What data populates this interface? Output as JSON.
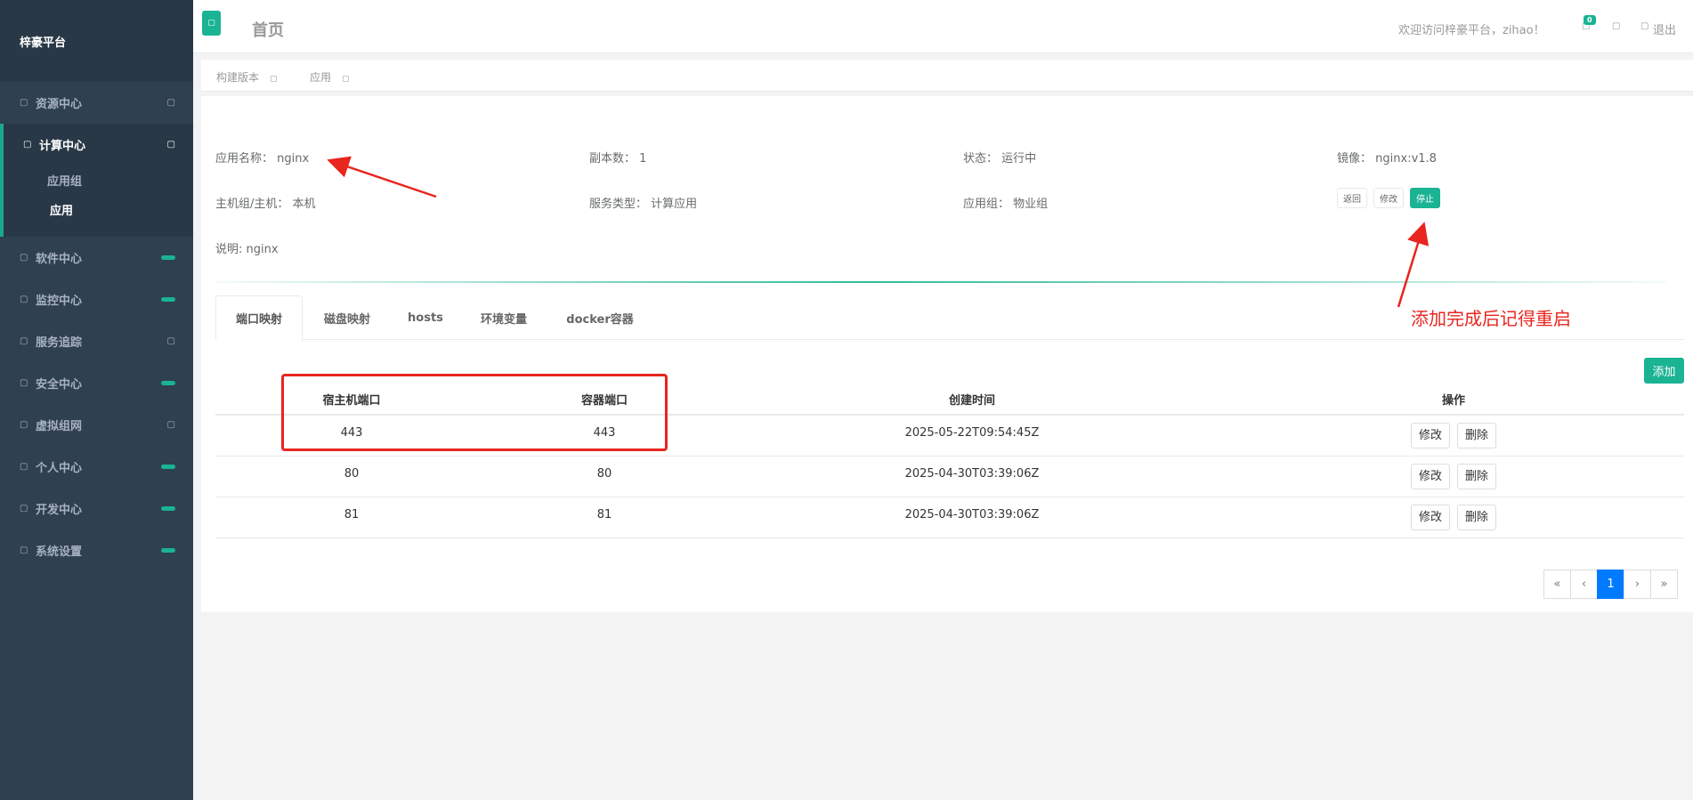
{
  "sidebar": {
    "brand": "梓豪平台",
    "items": [
      {
        "label": "资源中心"
      },
      {
        "label": "计算中心"
      },
      {
        "label": "软件中心"
      },
      {
        "label": "监控中心"
      },
      {
        "label": "服务追踪"
      },
      {
        "label": "安全中心"
      },
      {
        "label": "虚拟组网"
      },
      {
        "label": "个人中心"
      },
      {
        "label": "开发中心"
      },
      {
        "label": "系统设置"
      }
    ],
    "sub_items": [
      {
        "label": "应用组"
      },
      {
        "label": "应用"
      }
    ],
    "accent": "#1ab394"
  },
  "topbar": {
    "title": "首页",
    "welcome": "欢迎访问梓豪平台，zihao！",
    "badge": "0",
    "logout": "退出"
  },
  "page_tabs": [
    {
      "label": "构建版本"
    },
    {
      "label": "应用"
    }
  ],
  "details": {
    "name_label": "应用名称：",
    "name_value": "nginx",
    "replicas_label": "副本数：",
    "replicas_value": "1",
    "status_label": "状态：",
    "status_value": "运行中",
    "image_label": "镜像：",
    "image_value": "nginx:v1.8",
    "host_label": "主机组/主机：",
    "host_value": "本机",
    "service_type_label": "服务类型：",
    "service_type_value": "计算应用",
    "app_group_label": "应用组：",
    "app_group_value": "物业组",
    "desc_label": "说明:",
    "desc_value": "nginx"
  },
  "actions": {
    "back": "返回",
    "edit": "修改",
    "stop": "停止"
  },
  "tabs": [
    {
      "label": "端口映射"
    },
    {
      "label": "磁盘映射"
    },
    {
      "label": "hosts"
    },
    {
      "label": "环境变量"
    },
    {
      "label": "docker容器"
    }
  ],
  "add_button": "添加",
  "table": {
    "headers": [
      "宿主机端口",
      "容器端口",
      "创建时间",
      "操作"
    ],
    "rows": [
      {
        "host_port": "443",
        "container_port": "443",
        "created": "2025-05-22T09:54:45Z"
      },
      {
        "host_port": "80",
        "container_port": "80",
        "created": "2025-04-30T03:39:06Z"
      },
      {
        "host_port": "81",
        "container_port": "81",
        "created": "2025-04-30T03:39:06Z"
      }
    ],
    "edit_label": "修改",
    "delete_label": "删除"
  },
  "pagination": {
    "first": "«",
    "prev": "‹",
    "current": "1",
    "next": "›",
    "last": "»"
  },
  "annotation": {
    "text": "添加完成后记得重启",
    "color": "#e8251f"
  }
}
